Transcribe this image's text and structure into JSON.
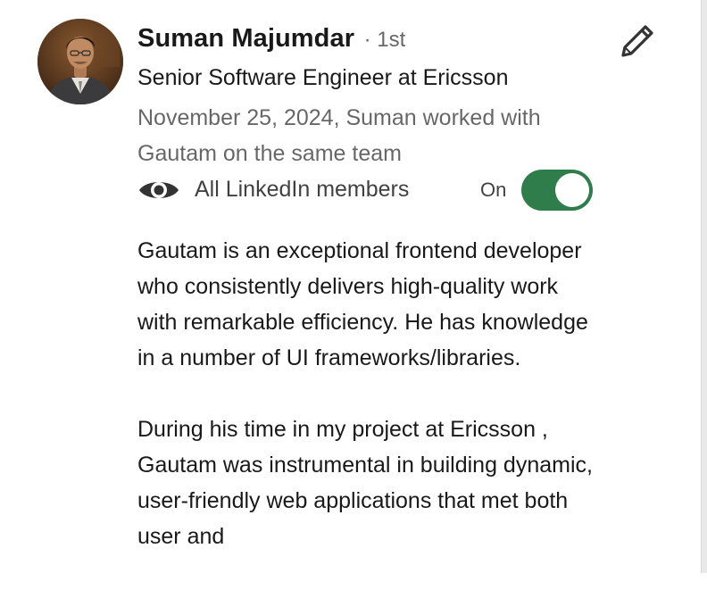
{
  "recommender": {
    "name": "Suman Majumdar",
    "degree": "· 1st",
    "headline": "Senior Software Engineer at Ericsson",
    "relationship": "November 25, 2024, Suman worked with Gautam on the same team"
  },
  "visibility": {
    "icon": "eye-icon",
    "label": "All LinkedIn members",
    "toggle_state": "On",
    "toggle_on": true,
    "accent_color": "#2f7d4a"
  },
  "edit": {
    "icon": "pencil-icon"
  },
  "recommendation": {
    "paragraph_1": "Gautam is an exceptional frontend developer who consistently delivers high-quality work with remarkable efficiency. He has knowledge in a number of UI frameworks/libraries.",
    "paragraph_2": "During his time in my project at Ericsson , Gautam was instrumental in building dynamic, user-friendly web applications that met both user and"
  }
}
